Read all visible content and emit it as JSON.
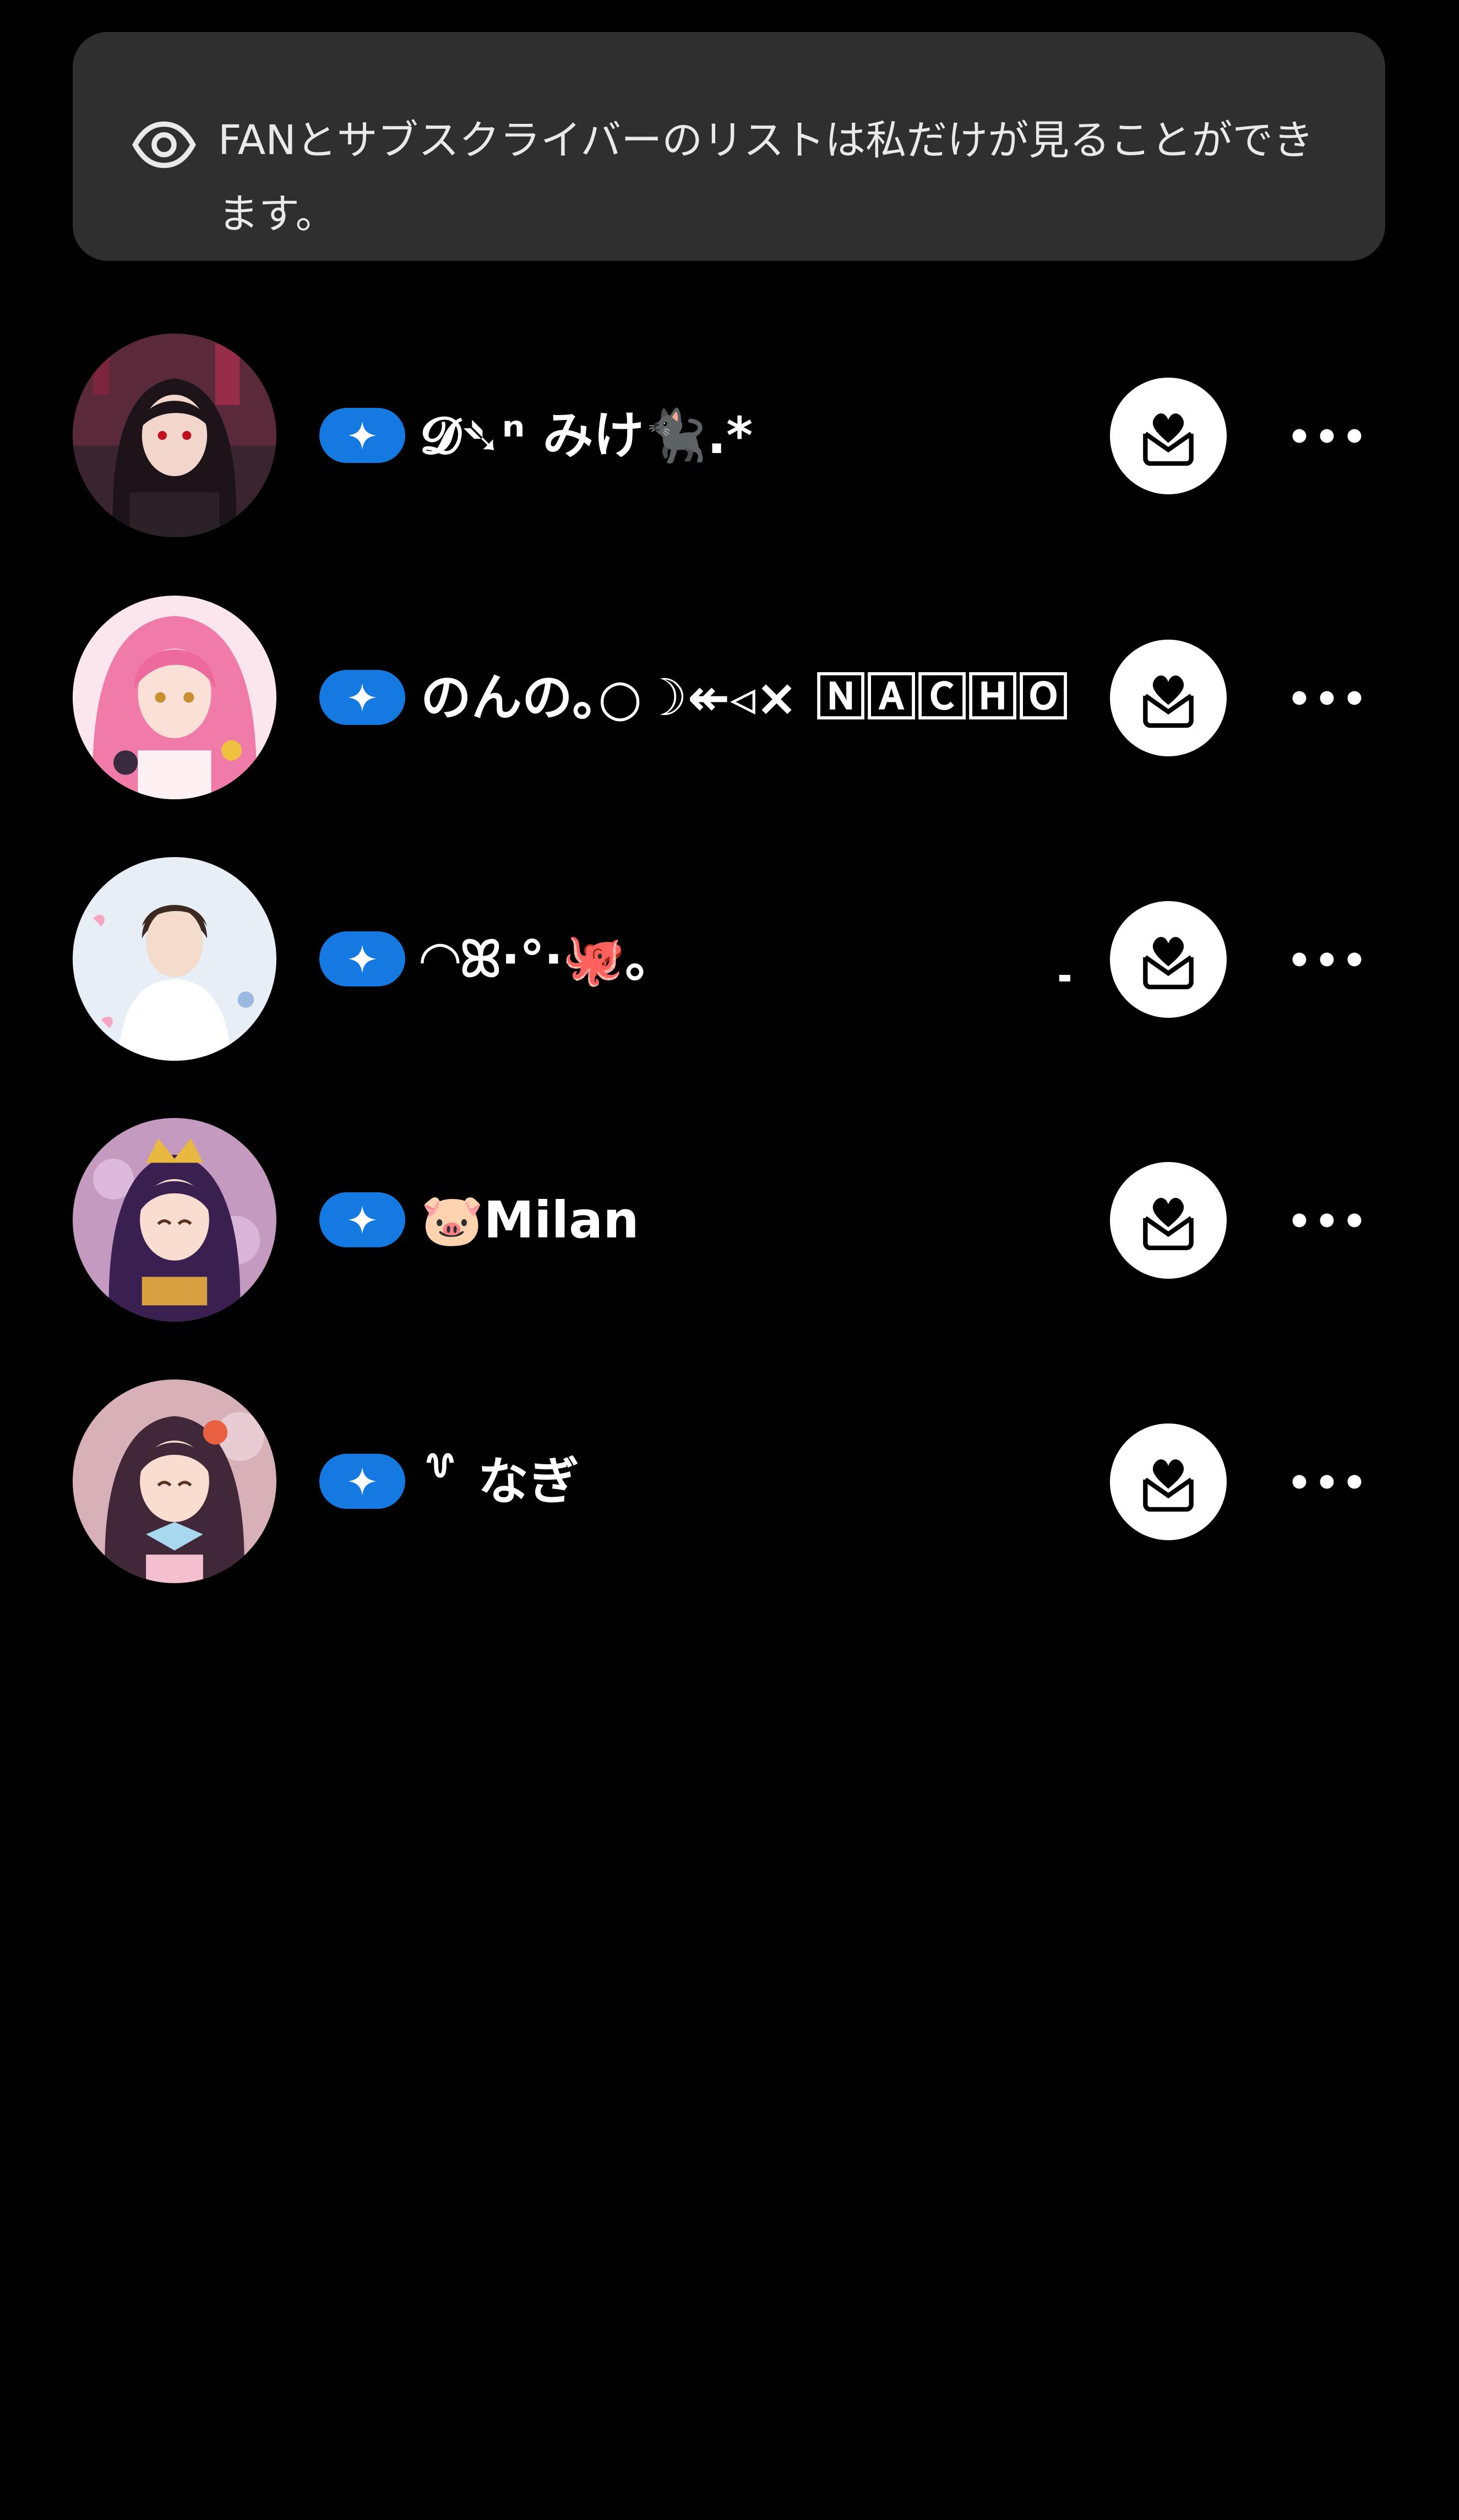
{
  "notice": {
    "icon": "eye-icon",
    "text": "FANとサブスクライバーのリストは私だけが見ることができます。"
  },
  "colors": {
    "background": "#000000",
    "notice_bg": "#2f2f2f",
    "badge": "#1479e0",
    "button_bg": "#ffffff"
  },
  "subscribers": [
    {
      "name": "𝓓➴ⁿ みけ🐈‍⬛.*",
      "badge_icon": "sparkle-icon",
      "action_icon": "heart-envelope-icon",
      "more_icon": "more-dots-icon",
      "avatar": "dark-haired-girl"
    },
    {
      "name": "のんの｡○☽↞◃× 🄽🄰🄲🄷🄾",
      "badge_icon": "sparkle-icon",
      "action_icon": "heart-envelope-icon",
      "more_icon": "more-dots-icon",
      "avatar": "pink-haired-girl"
    },
    {
      "name": "◠ꕤ‧°‧🐙｡",
      "badge_icon": "sparkle-icon",
      "action_icon": "heart-envelope-icon",
      "more_icon": "more-dots-icon",
      "avatar": "boy-white-shirt"
    },
    {
      "name": "🐷Milan",
      "badge_icon": "sparkle-icon",
      "action_icon": "heart-envelope-icon",
      "more_icon": "more-dots-icon",
      "avatar": "crowned-princess"
    },
    {
      "name": "꒷ なぎ",
      "badge_icon": "sparkle-icon",
      "action_icon": "heart-envelope-icon",
      "more_icon": "more-dots-icon",
      "avatar": "smiling-girl-bow"
    }
  ]
}
